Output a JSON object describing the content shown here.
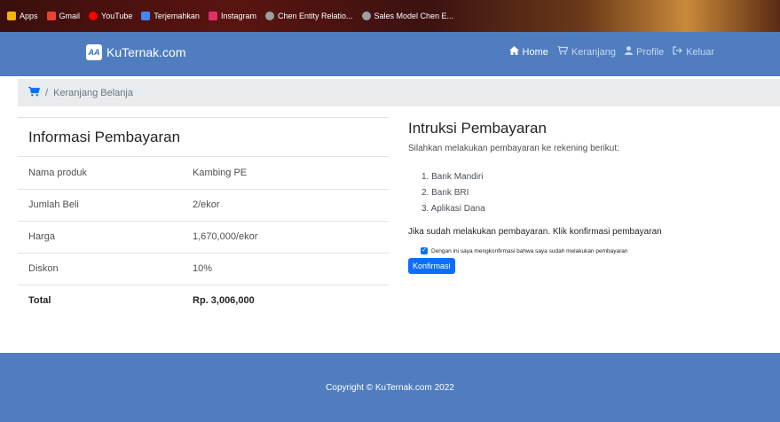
{
  "bookmarks": [
    {
      "label": "Apps",
      "icon": "apps-grid-icon",
      "color": "#f4b400"
    },
    {
      "label": "Gmail",
      "icon": "gmail-icon",
      "color": "#ea4335"
    },
    {
      "label": "YouTube",
      "icon": "youtube-icon",
      "color": "#ff0000"
    },
    {
      "label": "Terjemahkan",
      "icon": "translate-icon",
      "color": "#4285f4"
    },
    {
      "label": "Instagram",
      "icon": "instagram-icon",
      "color": "#e1306c"
    },
    {
      "label": "Chen Entity Relatio...",
      "icon": "site-icon",
      "color": "#9aa0a6"
    },
    {
      "label": "Sales Model Chen E...",
      "icon": "site-icon",
      "color": "#9aa0a6"
    }
  ],
  "navbar": {
    "brand_logo": "AA",
    "brand": "KuTernak.com",
    "links": [
      {
        "label": "Home",
        "icon": "home-icon",
        "active": true
      },
      {
        "label": "Keranjang",
        "icon": "cart-icon",
        "active": false
      },
      {
        "label": "Profile",
        "icon": "user-icon",
        "active": false
      },
      {
        "label": "Keluar",
        "icon": "logout-icon",
        "active": false
      }
    ]
  },
  "breadcrumb": {
    "icon": "cart-icon",
    "separator": "/",
    "current": "Keranjang Belanja"
  },
  "payment_info": {
    "title": "Informasi Pembayaran",
    "rows": [
      {
        "label": "Nama produk",
        "value": "Kambing PE"
      },
      {
        "label": "Jumlah Beli",
        "value": "2/ekor"
      },
      {
        "label": "Harga",
        "value": "1,670,000/ekor"
      },
      {
        "label": "Diskon",
        "value": "10%"
      },
      {
        "label": "Total",
        "value": "Rp. 3,006,000"
      }
    ]
  },
  "instructions": {
    "title": "Intruksi Pembayaran",
    "subtitle": "Silahkan melakukan pembayaran ke rekening berikut:",
    "banks": [
      "1. Bank Mandiri",
      "2. Bank BRI",
      "3. Aplikasi Dana"
    ],
    "note": "Jika sudah melakukan pembayaran. Klik konfirmasi pembayaran",
    "checkbox_label": "Dengan ini saya mengkonfirmasi bahwa saya sudah melakukan pembayaran",
    "checkbox_checked": true,
    "confirm_button": "Konfirmasi"
  },
  "footer": {
    "copyright": "Copyright © KuTernak.com 2022"
  },
  "colors": {
    "navbar": "#4f7dbf",
    "primary": "#0d6efd",
    "breadcrumb_bg": "#e9ecef"
  }
}
